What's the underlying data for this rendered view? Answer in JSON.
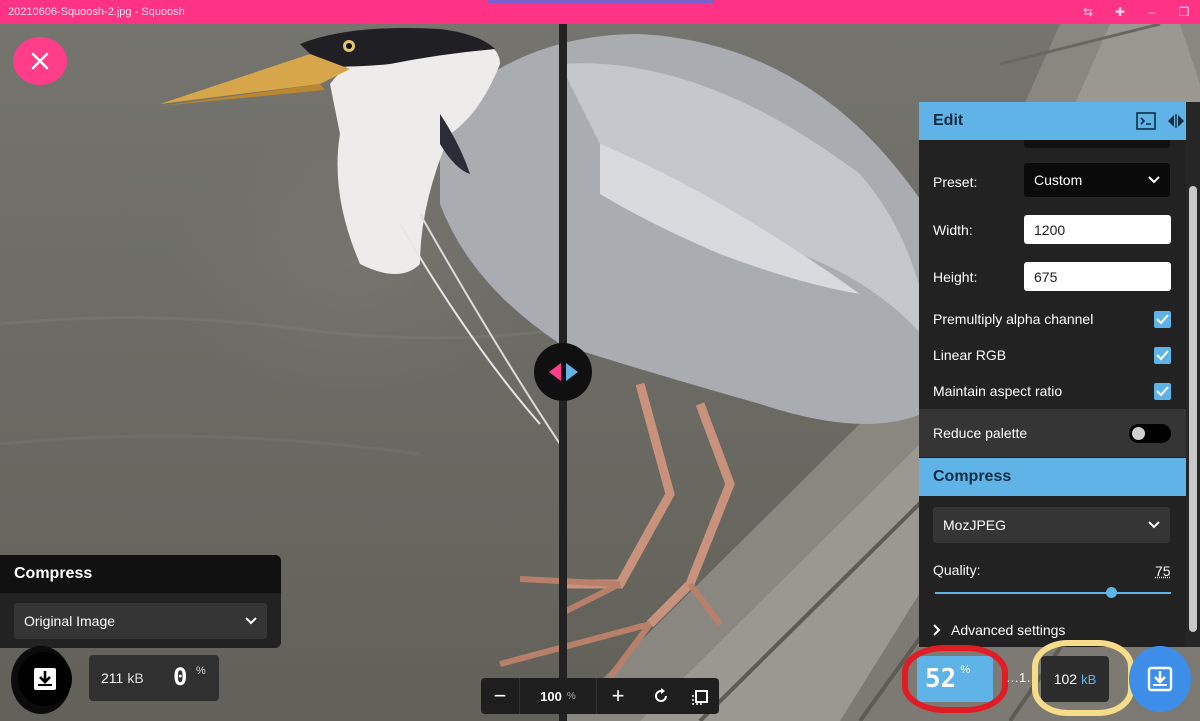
{
  "window": {
    "title": "20210606-Squoosh-2.jpg - Squoosh"
  },
  "titlebar_icons": [
    "translate-icon",
    "extensions-icon",
    "minimize-icon",
    "restore-icon"
  ],
  "left_panel": {
    "heading": "Compress",
    "select_value": "Original Image",
    "size_value": "211",
    "size_unit": "kB",
    "percent_value": "0",
    "percent_symbol": "%"
  },
  "zoom": {
    "minus": "−",
    "value": "100",
    "unit": "%",
    "plus": "+"
  },
  "right_panel": {
    "edit_heading": "Edit",
    "preset_label": "Preset:",
    "preset_value": "Custom",
    "width_label": "Width:",
    "width_value": "1200",
    "height_label": "Height:",
    "height_value": "675",
    "premultiply_label": "Premultiply alpha channel",
    "premultiply_checked": true,
    "linear_rgb_label": "Linear RGB",
    "linear_rgb_checked": true,
    "maintain_aspect_label": "Maintain aspect ratio",
    "maintain_aspect_checked": true,
    "reduce_palette_label": "Reduce palette",
    "reduce_palette_on": false,
    "compress_heading": "Compress",
    "codec_value": "MozJPEG",
    "quality_label": "Quality:",
    "quality_value": "75",
    "quality_fraction": 0.75,
    "advanced_label": "Advanced settings"
  },
  "result": {
    "percent_value": "52",
    "percent_symbol": "%",
    "dots_text": "…1…",
    "size_value": "102",
    "size_unit": "kB"
  },
  "colors": {
    "accent_pink": "#ff3385",
    "accent_blue": "#5fb3e6",
    "download_blue": "#3c8ee8",
    "annotation_red": "#e01c25",
    "annotation_yellow": "#f7dc8a"
  }
}
